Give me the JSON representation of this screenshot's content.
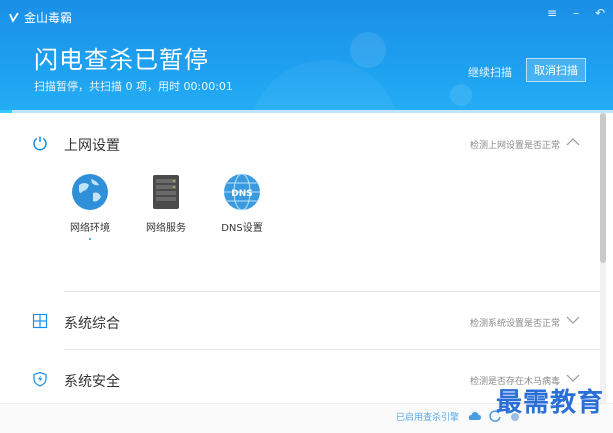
{
  "app": {
    "name": "金山毒霸"
  },
  "header": {
    "title": "闪电查杀已暂停",
    "status": "扫描暂停，共扫描 0 项，用时 00:00:01",
    "continue_label": "继续扫描",
    "cancel_label": "取消扫描",
    "progress": 0.02
  },
  "window_controls": [
    "menu",
    "minimize",
    "back"
  ],
  "sections": [
    {
      "title": "上网设置",
      "desc": "检测上网设置是否正常",
      "icon": "power-icon",
      "expanded": true,
      "items": [
        {
          "label": "网络环境",
          "icon": "globe-icon"
        },
        {
          "label": "网络服务",
          "icon": "server-icon"
        },
        {
          "label": "DNS设置",
          "icon": "dns-globe-icon",
          "icon_text": "DNS"
        }
      ]
    },
    {
      "title": "系统综合",
      "desc": "检测系统设置是否正常",
      "icon": "windows-icon",
      "expanded": false
    },
    {
      "title": "系统安全",
      "desc": "检测是否存在木马病毒",
      "icon": "shield-icon",
      "expanded": false
    }
  ],
  "footer": {
    "text": "已启用查杀引擎"
  },
  "watermark": "最需教育",
  "colors": {
    "header": "#1a8fe6",
    "accent": "#39c7ff",
    "watermark": "#2a6fd8"
  }
}
